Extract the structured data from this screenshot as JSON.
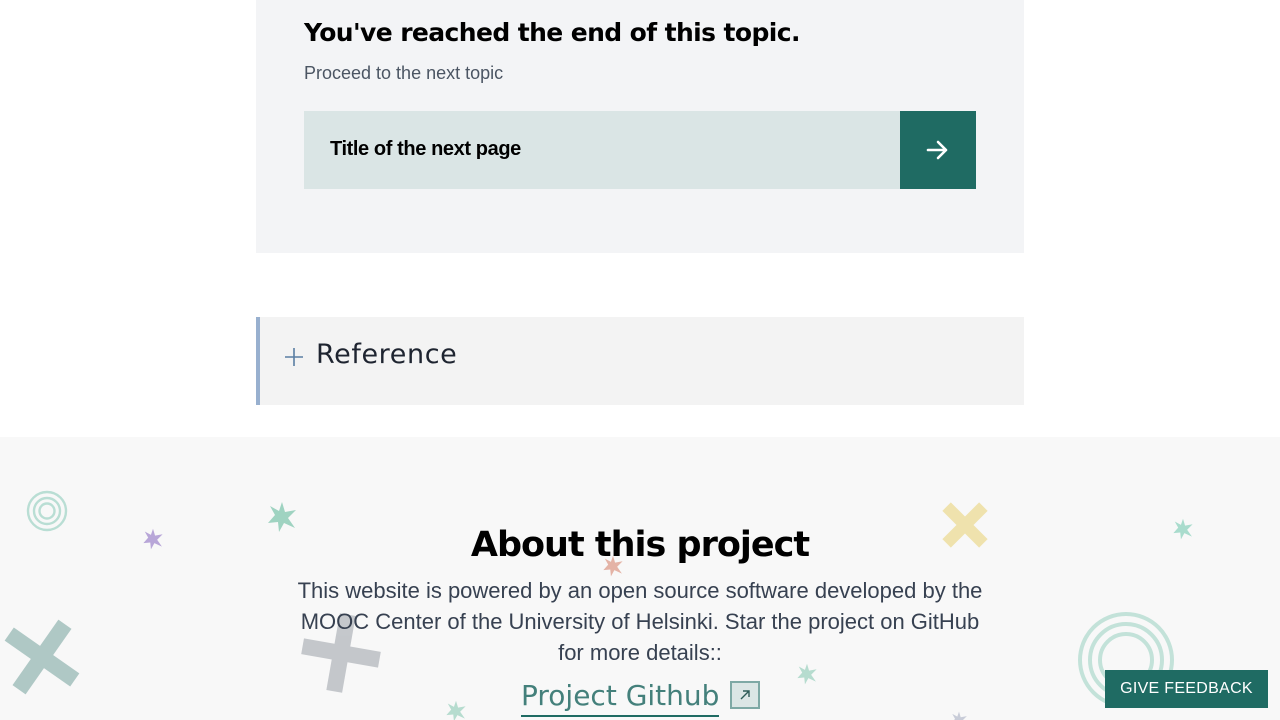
{
  "end_card": {
    "title": "You've reached the end of this topic.",
    "subtitle": "Proceed to the next topic",
    "next_page_title": "Title of the next page",
    "arrow_icon": "arrow-right-icon"
  },
  "reference": {
    "label": "Reference",
    "icon": "plus-icon"
  },
  "about": {
    "title": "About this project",
    "text": "This website is powered by an open source software developed by the MOOC Center of the University of Helsinki. Star the project on GitHub for more details::",
    "github_link": "Project Github",
    "external_icon": "external-link-icon"
  },
  "feedback_button": "GIVE FEEDBACK",
  "colors": {
    "accent": "#1f6b63",
    "card_bg": "#f3f4f6",
    "link_bg": "#dae5e5",
    "reference_border": "#98b0cf"
  }
}
